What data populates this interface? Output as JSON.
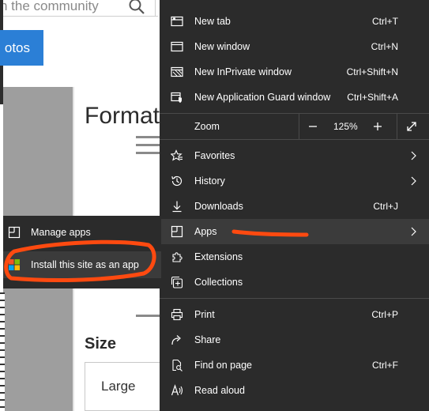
{
  "background_page": {
    "search_placeholder": "h the community",
    "photos_button": "otos",
    "section_title": "Format",
    "size_label": "Size",
    "size_value": "Large"
  },
  "menu": {
    "new_tab": {
      "label": "New tab",
      "shortcut": "Ctrl+T"
    },
    "new_window": {
      "label": "New window",
      "shortcut": "Ctrl+N"
    },
    "new_inprivate": {
      "label": "New InPrivate window",
      "shortcut": "Ctrl+Shift+N"
    },
    "new_guard": {
      "label": "New Application Guard window",
      "shortcut": "Ctrl+Shift+A"
    },
    "zoom": {
      "label": "Zoom",
      "minus": "−",
      "value": "125%",
      "plus": "+"
    },
    "favorites": {
      "label": "Favorites"
    },
    "history": {
      "label": "History"
    },
    "downloads": {
      "label": "Downloads",
      "shortcut": "Ctrl+J"
    },
    "apps": {
      "label": "Apps"
    },
    "extensions": {
      "label": "Extensions"
    },
    "collections": {
      "label": "Collections"
    },
    "print": {
      "label": "Print",
      "shortcut": "Ctrl+P"
    },
    "share": {
      "label": "Share"
    },
    "find": {
      "label": "Find on page",
      "shortcut": "Ctrl+F"
    },
    "read_aloud": {
      "label": "Read aloud"
    }
  },
  "apps_submenu": {
    "manage": "Manage apps",
    "install": "Install this site as an app"
  },
  "colors": {
    "menu_bg": "#2b2b2b",
    "menu_hover": "#3b3b3b",
    "annotation": "#ff4a10",
    "accent_blue": "#2b7fd6"
  }
}
